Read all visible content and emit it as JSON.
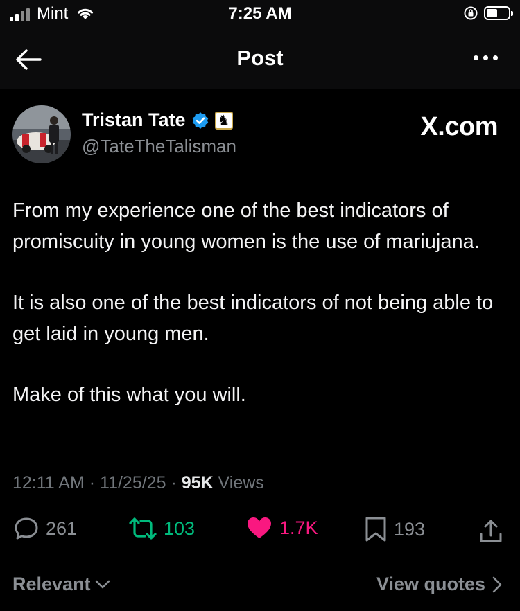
{
  "status_bar": {
    "carrier": "Mint",
    "time": "7:25 AM"
  },
  "header": {
    "title": "Post"
  },
  "author": {
    "name": "Tristan Tate",
    "handle": "@TateTheTalisman",
    "badge_emoji": "♞",
    "watermark": "X.com"
  },
  "post": {
    "paragraphs": [
      "From my experience one of the best indicators of promiscuity in young women is the use of mariujana.",
      "It is also one of the best indicators of not being able to get laid in young men.",
      "Make of this what you will."
    ],
    "time": "12:11 AM",
    "date": "11/25/25",
    "views_count": "95K",
    "views_label": "Views"
  },
  "actions": {
    "replies": "261",
    "reposts": "103",
    "likes": "1.7K",
    "bookmarks": "193"
  },
  "footer": {
    "sort_label": "Relevant",
    "quotes_label": "View quotes"
  },
  "colors": {
    "background": "#000000",
    "repost": "#00ba7c",
    "like": "#f91880",
    "verified": "#1d9bf0",
    "muted": "#71767b"
  },
  "icons": {
    "back": "arrow-left-icon",
    "more": "more-dots-icon",
    "reply": "speech-bubble-icon",
    "repost": "repost-arrows-icon",
    "like": "heart-filled-icon",
    "bookmark": "bookmark-icon",
    "share": "share-upload-icon"
  }
}
